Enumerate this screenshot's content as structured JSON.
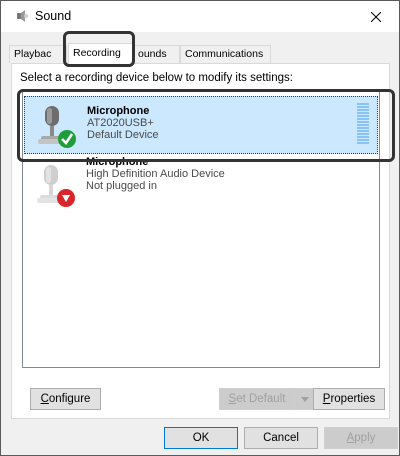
{
  "window": {
    "title": "Sound",
    "icon": "speaker-icon",
    "close_icon": "close-icon"
  },
  "tabs": [
    {
      "label": "Playbac",
      "active": false
    },
    {
      "label": "Recording",
      "active": true
    },
    {
      "label": "ounds",
      "active": false
    },
    {
      "label": "Communications",
      "active": false
    }
  ],
  "panel": {
    "instruction": "Select a recording device below to modify its settings:"
  },
  "devices": [
    {
      "name": "Microphone",
      "model": "AT2020USB+",
      "status": "Default Device",
      "badge": "check-icon",
      "selected": true
    },
    {
      "name": "Microphone",
      "model": "High Definition Audio Device",
      "status": "Not plugged in",
      "badge": "down-arrow-icon",
      "selected": false
    }
  ],
  "buttons": {
    "configure_pre": "",
    "configure_ul": "C",
    "configure_post": "onfigure",
    "setdefault_ul": "S",
    "setdefault_post": "et Default",
    "properties_ul": "P",
    "properties_post": "roperties",
    "ok": "OK",
    "cancel": "Cancel",
    "apply_ul": "A",
    "apply_post": "pply"
  },
  "colors": {
    "selected_bg": "#cce8ff",
    "badge_green": "#1e9e3a",
    "badge_red": "#d9262b",
    "ok_border": "#0078d7"
  }
}
